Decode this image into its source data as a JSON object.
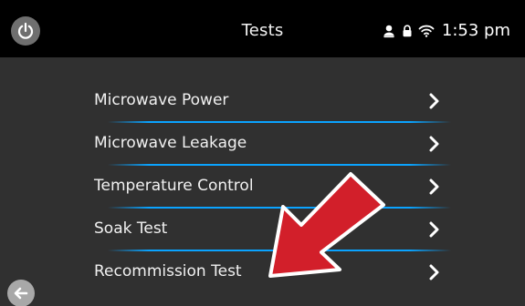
{
  "header": {
    "title": "Tests",
    "time": "1:53 pm",
    "power_icon": "power-icon",
    "status_icons": [
      "person-icon",
      "lock-icon",
      "wifi-icon"
    ]
  },
  "menu": {
    "items": [
      {
        "label": "Microwave Power",
        "icon": "chevron-right-icon"
      },
      {
        "label": "Microwave Leakage",
        "icon": "chevron-right-icon"
      },
      {
        "label": "Temperature Control",
        "icon": "chevron-right-icon"
      },
      {
        "label": "Soak Test",
        "icon": "chevron-right-icon"
      },
      {
        "label": "Recommission Test",
        "icon": "chevron-right-icon"
      }
    ]
  },
  "footer": {
    "back_icon": "back-arrow-icon"
  },
  "colors": {
    "topbar": "#000000",
    "background": "#303030",
    "accent": "#0aa3ff",
    "annotation_red": "#d21f2a",
    "text": "#f1f1f1"
  }
}
